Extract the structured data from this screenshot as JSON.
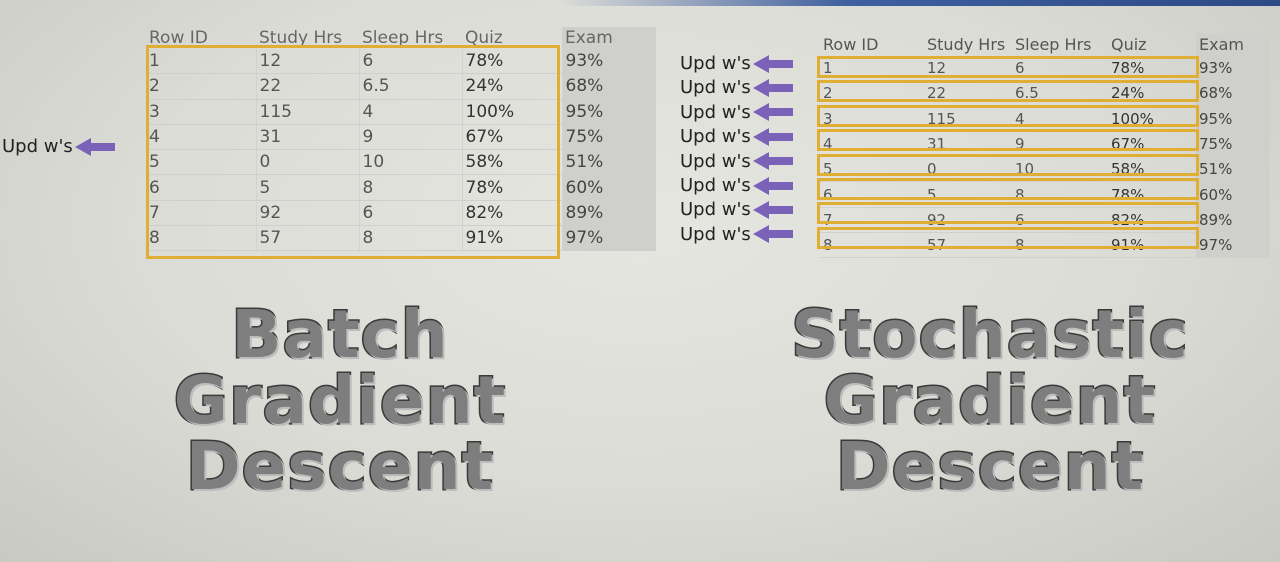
{
  "headers": [
    "Row ID",
    "Study Hrs",
    "Sleep Hrs",
    "Quiz",
    "Exam"
  ],
  "rows": [
    [
      "1",
      "12",
      "6",
      "78%",
      "93%"
    ],
    [
      "2",
      "22",
      "6.5",
      "24%",
      "68%"
    ],
    [
      "3",
      "115",
      "4",
      "100%",
      "95%"
    ],
    [
      "4",
      "31",
      "9",
      "67%",
      "75%"
    ],
    [
      "5",
      "0",
      "10",
      "58%",
      "51%"
    ],
    [
      "6",
      "5",
      "8",
      "78%",
      "60%"
    ],
    [
      "7",
      "92",
      "6",
      "82%",
      "89%"
    ],
    [
      "8",
      "57",
      "8",
      "91%",
      "97%"
    ]
  ],
  "update_label": "Upd w's",
  "batch_title": [
    "Batch",
    "Gradient",
    "Descent"
  ],
  "sgd_title": [
    "Stochastic",
    "Gradient",
    "Descent"
  ],
  "colors": {
    "highlight": "#e1ad33",
    "arrow": "#7a62b8",
    "exam_column": "#cfcfcc"
  }
}
